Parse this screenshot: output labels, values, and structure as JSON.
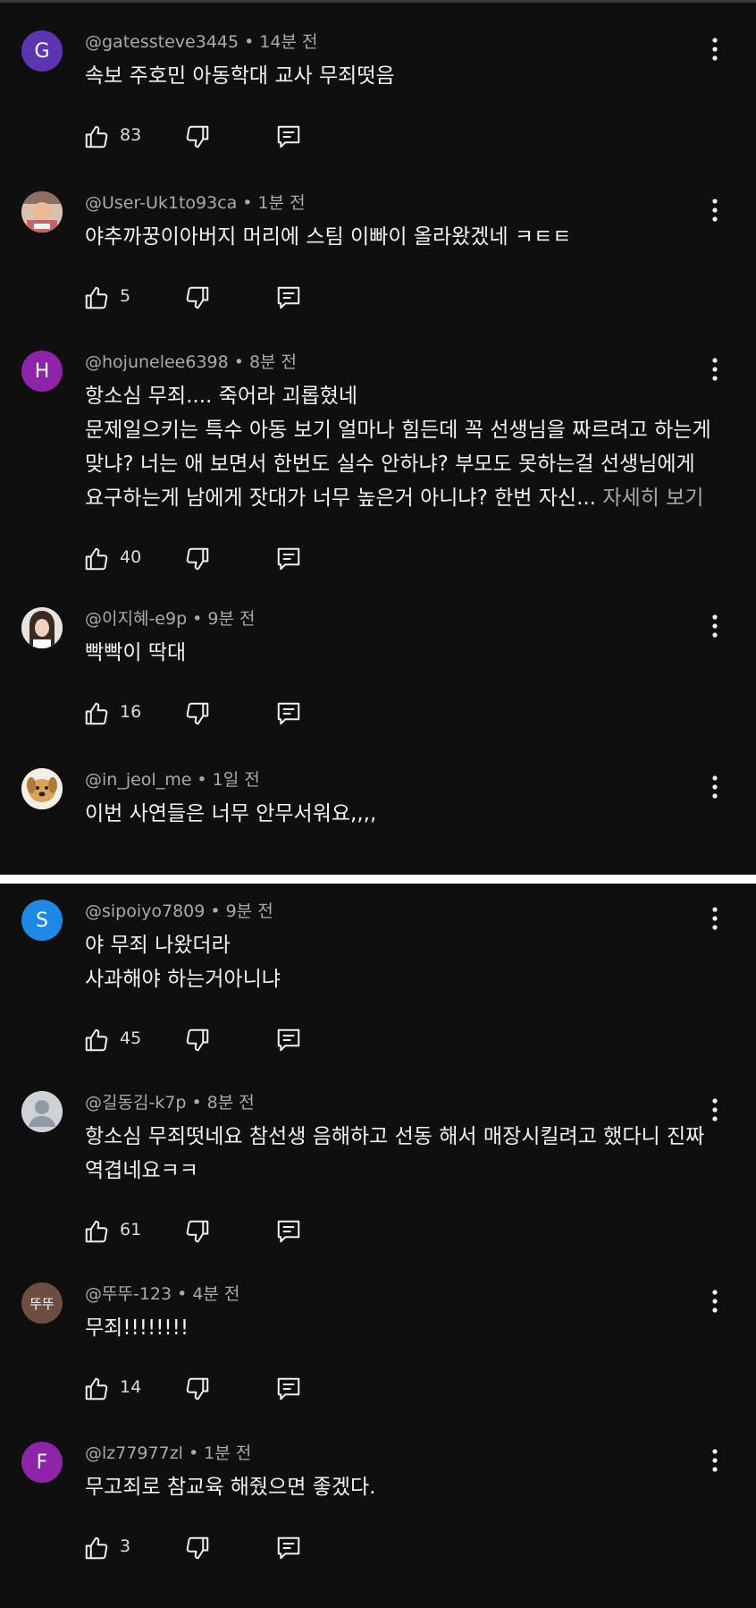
{
  "comments": [
    {
      "handle": "@gatessteve3445",
      "time": "14분 전",
      "avatar_letter": "G",
      "avatar_color": "#5e35b1",
      "lines": [
        "속보 주호민 아동학대 교사 무죄떳음"
      ],
      "likes": "83"
    },
    {
      "handle": "@User-Uk1to93ca",
      "time": "1분 전",
      "avatar_letter": "",
      "avatar_color": "#d9c3b0",
      "avatar_icon": "photo-avatar-icon",
      "lines": [
        "야추까꿍이아버지 머리에 스팀 이빠이 올라왔겠네 ㅋㅌㅌ"
      ],
      "likes": "5"
    },
    {
      "handle": "@hojunelee6398",
      "time": "8분 전",
      "avatar_letter": "H",
      "avatar_color": "#8e24aa",
      "lines": [
        "항소심 무죄.... 죽어라 괴롭혔네",
        "문제일으키는 특수 아동 보기 얼마나 힘든데 꼭 선생님을 짜르려고 하는게",
        "맞냐? 너는 애 보면서 한번도 실수 안하냐? 부모도 못하는걸 선생님에게",
        "요구하는게 남에게 잣대가 너무 높은거 아니냐? 한번 자신..."
      ],
      "more_label": "자세히 보기",
      "likes": "40"
    },
    {
      "handle": "@이지혜-e9p",
      "time": "9분 전",
      "avatar_letter": "",
      "avatar_color": "#e9e1da",
      "avatar_icon": "photo-avatar-icon",
      "lines": [
        "빡빡이 딱대"
      ],
      "likes": "16"
    },
    {
      "handle": "@in_jeol_me",
      "time": "1일 전",
      "avatar_letter": "",
      "avatar_color": "#f3efe6",
      "avatar_icon": "dog-avatar-icon",
      "lines": [
        "이번 사연들은 너무 안무서워요,,,,"
      ],
      "likes": ""
    },
    {
      "handle": "@sipoiyo7809",
      "time": "9분 전",
      "avatar_letter": "S",
      "avatar_color": "#1e88e5",
      "lines": [
        "야 무죄 나왔더라",
        "사과해야 하는거아니냐"
      ],
      "likes": "45"
    },
    {
      "handle": "@길동김-k7p",
      "time": "8분 전",
      "avatar_letter": "",
      "avatar_color": "#cfd3d8",
      "avatar_icon": "default-user-icon",
      "lines": [
        "항소심 무죄떳네요 참선생 음해하고 선동 해서 매장시킬려고 했다니 진짜",
        "역겹네요ㅋㅋ"
      ],
      "likes": "61"
    },
    {
      "handle": "@뚜뚜-123",
      "time": "4분 전",
      "avatar_letter": "뚜뚜",
      "avatar_color": "#6d4c41",
      "lines": [
        "무죄!!!!!!!!"
      ],
      "likes": "14"
    },
    {
      "handle": "@lz77977zl",
      "time": "1분 전",
      "avatar_letter": "F",
      "avatar_color": "#8e24aa",
      "lines": [
        "무고죄로 참교육 해줬으면 좋겠다."
      ],
      "likes": "3"
    }
  ]
}
